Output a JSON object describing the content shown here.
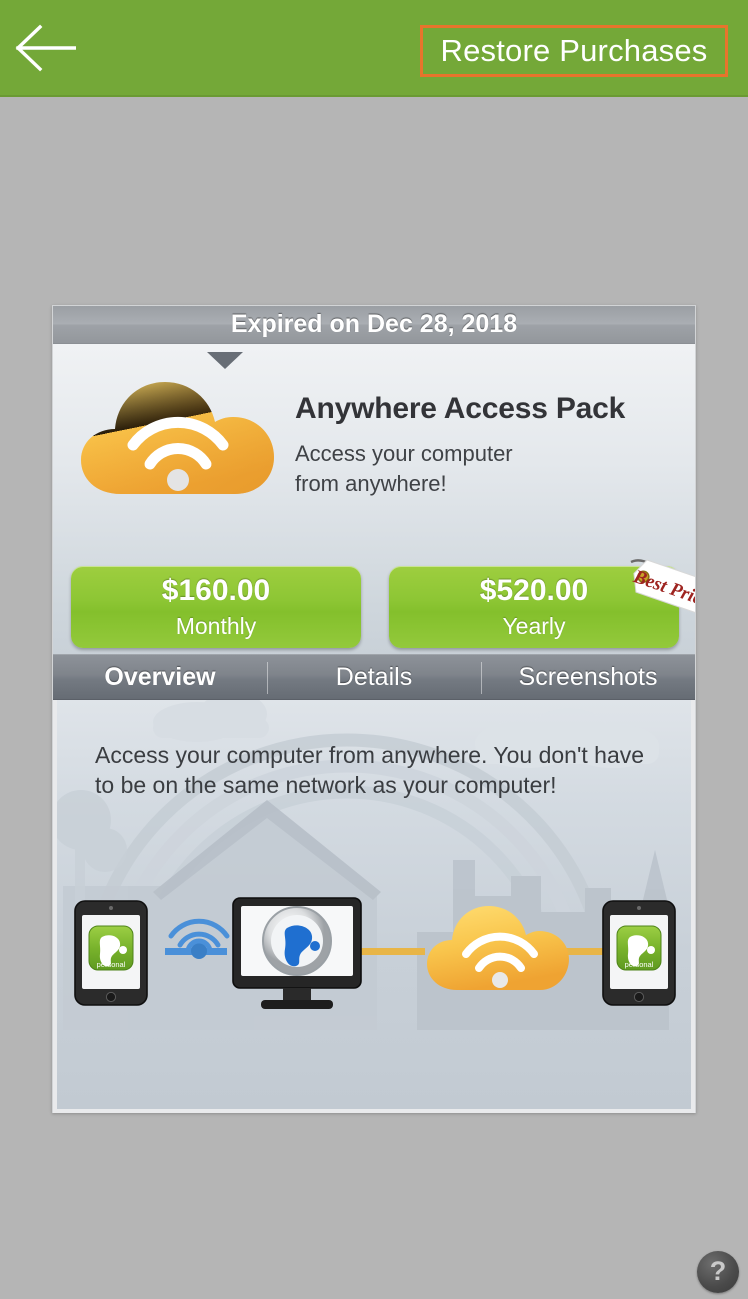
{
  "header": {
    "back_icon": "back-arrow-icon",
    "restore_label": "Restore Purchases",
    "bar_color": "#74a838",
    "highlight_color": "#e8742c"
  },
  "card": {
    "banner_text": "Expired on Dec 28, 2018",
    "pack_title": "Anywhere Access Pack",
    "pack_subtitle": "Access your computer\nfrom anywhere!",
    "logo_icon": "cloud-wifi-icon",
    "prices": [
      {
        "amount": "$160.00",
        "period": "Monthly",
        "badge": ""
      },
      {
        "amount": "$520.00",
        "period": "Yearly",
        "badge": "Best Price"
      }
    ],
    "tabs": [
      {
        "label": "Overview",
        "active": true
      },
      {
        "label": "Details",
        "active": false
      },
      {
        "label": "Screenshots",
        "active": false
      }
    ],
    "overview_text": "Access your computer from anywhere. You don't have to be on the same network as your computer!",
    "diagram_items": [
      "tablet-personal-icon",
      "wifi-icon",
      "monitor-splashtop-icon",
      "cloud-wifi-icon",
      "tablet-personal-icon"
    ],
    "tablet_app_label": "personal"
  },
  "help": {
    "label": "?",
    "icon": "question-mark-icon"
  },
  "colors": {
    "page_background": "#b5b5b5",
    "green_button": "#8dc634",
    "tag_text": "#9e2420"
  }
}
